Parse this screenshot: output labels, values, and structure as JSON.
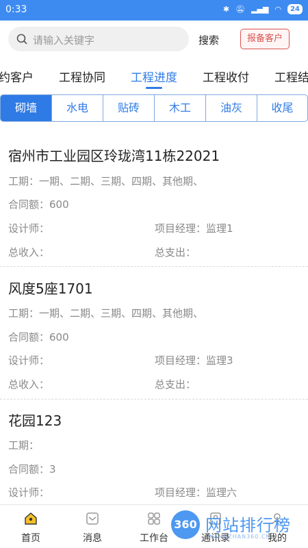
{
  "status_bar": {
    "time": "0:33",
    "battery": "24"
  },
  "search": {
    "placeholder": "请输入关键字",
    "button": "搜索",
    "report_button": "报备客户"
  },
  "tabs": [
    {
      "label": "约客户"
    },
    {
      "label": "工程协同"
    },
    {
      "label": "工程进度"
    },
    {
      "label": "工程收付"
    },
    {
      "label": "工程结"
    }
  ],
  "subtabs": [
    {
      "label": "砌墙"
    },
    {
      "label": "水电"
    },
    {
      "label": "贴砖"
    },
    {
      "label": "木工"
    },
    {
      "label": "油灰"
    },
    {
      "label": "收尾"
    }
  ],
  "projects": [
    {
      "title": "宿州市工业园区玲珑湾11栋22021",
      "period": "工期：一期、二期、三期、四期、其他期、",
      "contract": "合同额：600",
      "designer": "设计师：",
      "manager": "项目经理：监理1",
      "income": "总收入：",
      "expense": "总支出："
    },
    {
      "title": "风度5座1701",
      "period": "工期：一期、二期、三期、四期、其他期、",
      "contract": "合同额：600",
      "designer": "设计师：",
      "manager": "项目经理：监理3",
      "income": "总收入：",
      "expense": "总支出："
    },
    {
      "title": "花园123",
      "period": "工期：",
      "contract": "合同额：3",
      "designer": "设计师：",
      "manager": "项目经理：监理六"
    }
  ],
  "bottom_nav": [
    {
      "label": "首页",
      "icon": "home-icon"
    },
    {
      "label": "消息",
      "icon": "message-icon"
    },
    {
      "label": "工作台",
      "icon": "grid-icon"
    },
    {
      "label": "通讯录",
      "icon": "contacts-icon"
    },
    {
      "label": "我的",
      "icon": "user-icon"
    }
  ],
  "watermark": {
    "badge": "360",
    "text": "网站排行榜",
    "sub": "WANGZHAN360.CN"
  },
  "colors": {
    "primary": "#2f7be6",
    "status_bar": "#3d8bf0",
    "report": "#d9534f"
  }
}
